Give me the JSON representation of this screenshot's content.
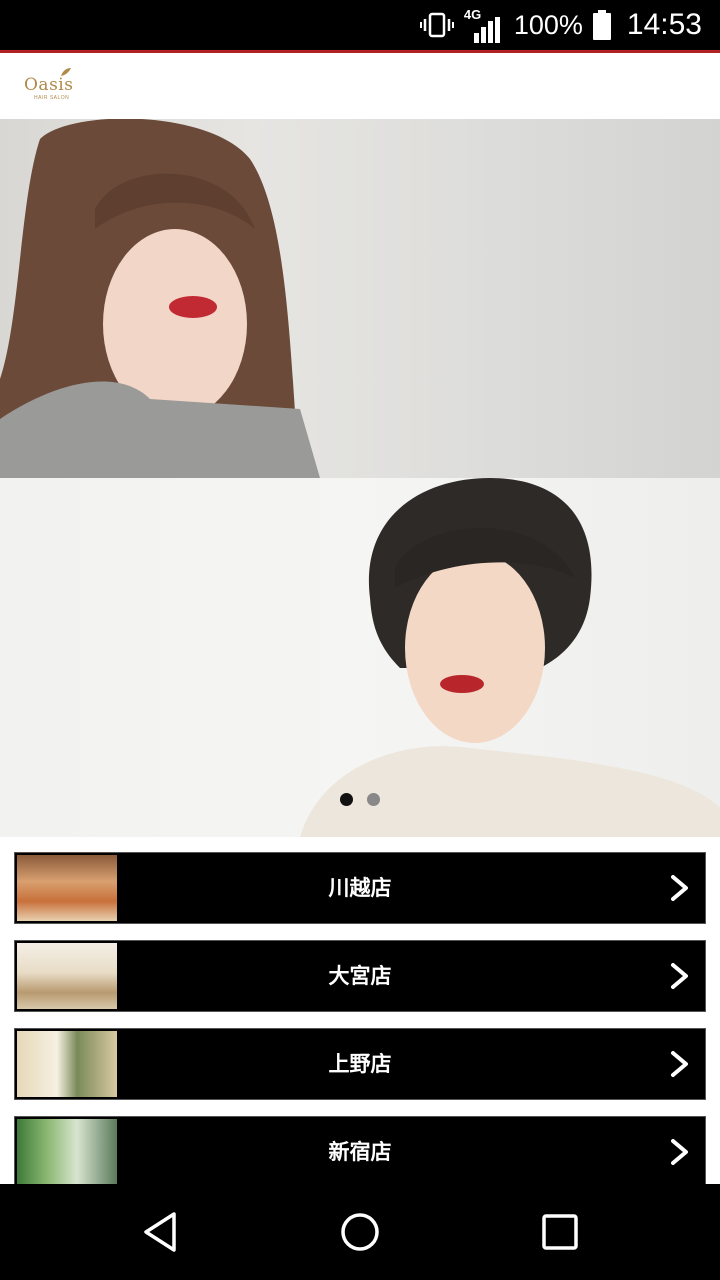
{
  "status_bar": {
    "network": "4G",
    "battery": "100%",
    "time": "14:53",
    "icons": [
      "vibrate-icon",
      "signal-icon",
      "battery-icon"
    ]
  },
  "colors": {
    "accent_line": "#b22222",
    "logo_gold": "#b08a4a",
    "store_row_bg": "#000000",
    "store_text": "#ffffff"
  },
  "header": {
    "logo_text": "Oasis",
    "logo_subtext": "HAIR SALON"
  },
  "carousel": {
    "slide_count": 2,
    "active_index": 0
  },
  "stores": [
    {
      "label": "川越店",
      "thumb_icon": "salon-photo-icon"
    },
    {
      "label": "大宮店",
      "thumb_icon": "salon-photo-icon"
    },
    {
      "label": "上野店",
      "thumb_icon": "salon-photo-icon"
    },
    {
      "label": "新宿店",
      "thumb_icon": "salon-photo-icon"
    }
  ],
  "nav_bar": {
    "icons": [
      "back-icon",
      "home-icon",
      "recents-icon"
    ]
  }
}
